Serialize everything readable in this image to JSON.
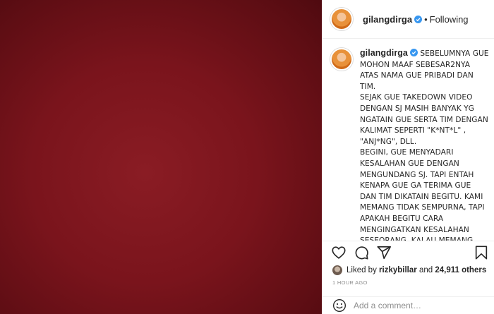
{
  "post": {
    "username": "gilangdirga",
    "follow_status": "Following",
    "separator": "•"
  },
  "caption": {
    "username": "gilangdirga",
    "text": "SEBELUMNYA GUE MOHON MAAF SEBESAR2NYA ATAS NAMA GUE PRIBADI DAN TIM.\nSEJAK GUE TAKEDOWN VIDEO DENGAN SJ MASIH BANYAK YG NGATAIN GUE SERTA TIM DENGAN KALIMAT SEPERTI \"K*NT*L\" , \"ANJ*NG\", DLL.\nBEGINI, GUE MENYADARI KESALAHAN GUE DENGAN MENGUNDANG SJ. TAPI ENTAH KENAPA GUE GA TERIMA GUE DAN TIM DIKATAIN BEGITU. KAMI MEMANG TIDAK SEMPURNA, TAPI APAKAH BEGITU CARA MENGINGATKAN KESALAHAN SESEORANG, KALAU MEMANG IYA, SEBAIKNYA KITA KETEMUAN AJA LANGSUNG BUAT NGOBROL ,"
  },
  "actions": {
    "like": "heart-icon",
    "comment": "comment-icon",
    "share": "share-icon",
    "save": "bookmark-icon"
  },
  "likes": {
    "prefix": "Liked by",
    "user": "rizkybillar",
    "connector": "and",
    "others": "24,911 others"
  },
  "timestamp": "1 HOUR AGO",
  "comment": {
    "placeholder": "Add a comment…"
  },
  "colors": {
    "media_background": "#7a141c",
    "verified": "#3897f0",
    "muted_text": "#8e8e8e"
  }
}
